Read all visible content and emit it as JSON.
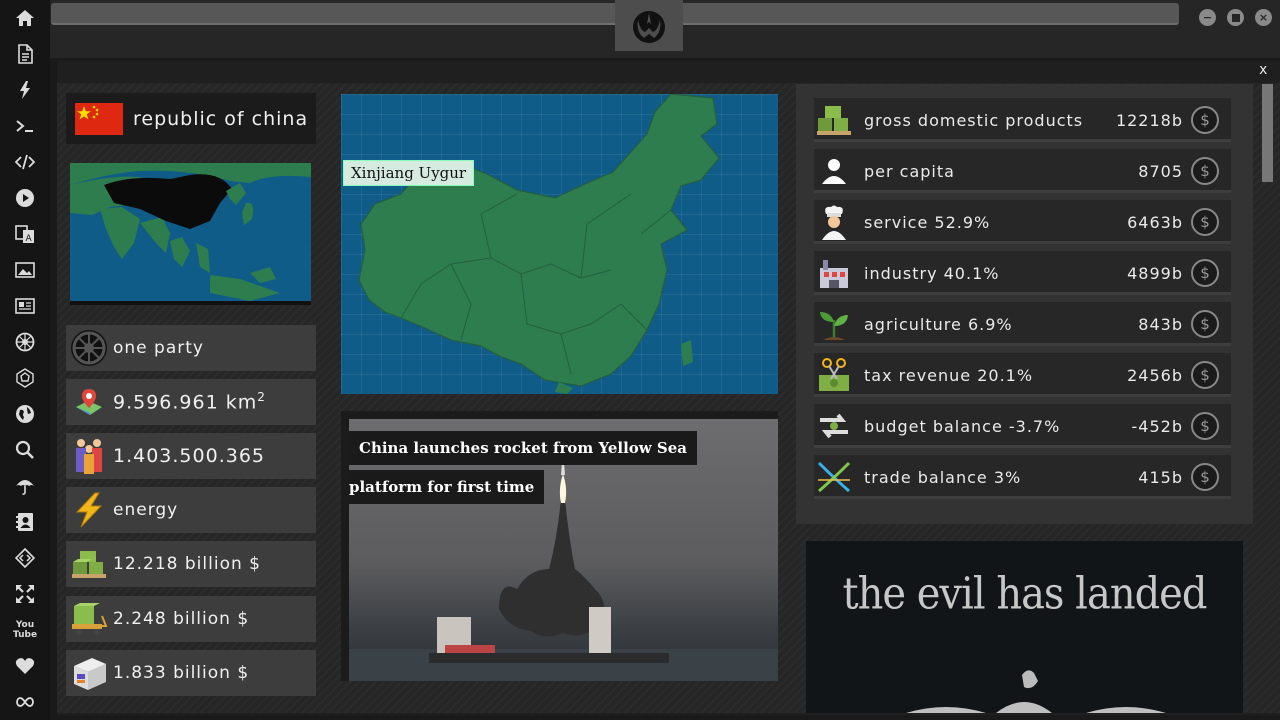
{
  "sidebar": {
    "icons": [
      "home-icon",
      "document-icon",
      "bolt-icon",
      "terminal-icon",
      "code-icon",
      "play-icon",
      "translate-icon",
      "image-icon",
      "newspaper-icon",
      "empire-icon",
      "dodecahedron-icon",
      "globe-icon",
      "search-icon",
      "umbrella-icon",
      "contacts-icon",
      "diamond-code-icon",
      "fullscreen-icon",
      "youtube-icon",
      "heart-icon",
      "infinity-icon"
    ],
    "youtube_label": "You\nTube"
  },
  "window": {
    "close_label": "x"
  },
  "country": {
    "name": "republic of china",
    "government": "one party",
    "area": "9.596.961 km",
    "area_unit_sup": "2",
    "population": "1.403.500.365",
    "resource": "energy",
    "gdp_total": "12.218 billion $",
    "stat2": "2.248 billion $",
    "stat3": "1.833 billion $"
  },
  "map": {
    "tooltip": "Xinjiang Uygur"
  },
  "news": {
    "headline_line1": "China launches rocket from Yellow Sea",
    "headline_line2": "platform for first time"
  },
  "economy": [
    {
      "label": "gross domestic products",
      "value": "12218b",
      "icon": "money-pallet-icon"
    },
    {
      "label": "per capita",
      "value": "8705",
      "icon": "person-icon"
    },
    {
      "label": "service 52.9%",
      "value": "6463b",
      "icon": "chef-icon"
    },
    {
      "label": "industry 40.1%",
      "value": "4899b",
      "icon": "factory-icon"
    },
    {
      "label": "agriculture 6.9%",
      "value": "843b",
      "icon": "plant-icon"
    },
    {
      "label": "tax revenue 20.1%",
      "value": "2456b",
      "icon": "scissors-cash-icon"
    },
    {
      "label": "budget balance -3.7%",
      "value": "-452b",
      "icon": "exchange-icon"
    },
    {
      "label": "trade balance 3%",
      "value": "415b",
      "icon": "trade-cross-icon"
    }
  ],
  "coin_symbol": "$",
  "promo": {
    "title": "the evil has landed"
  },
  "colors": {
    "map_ocean": "#0f5c89",
    "land": "#2e7d4f",
    "flag_red": "#de2910",
    "flag_star": "#ffde00"
  }
}
